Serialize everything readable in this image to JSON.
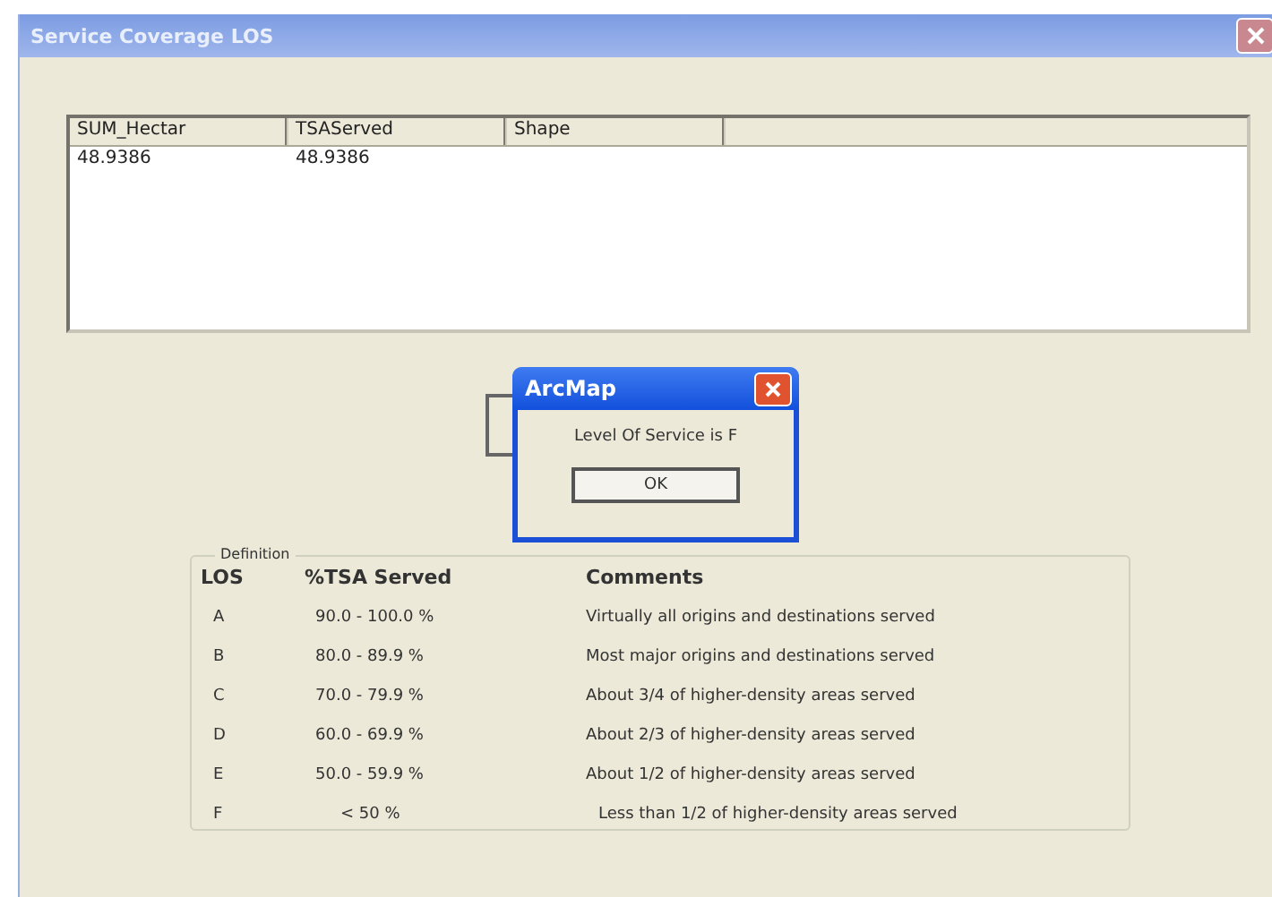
{
  "window": {
    "title": "Service Coverage LOS"
  },
  "table": {
    "columns": [
      "SUM_Hectar",
      "TSAServed",
      "Shape"
    ],
    "rows": [
      [
        "48.9386",
        "48.9386"
      ]
    ]
  },
  "message_box": {
    "title": "ArcMap",
    "message": "Level Of Service is F",
    "button": "OK"
  },
  "definition": {
    "title": "Definition",
    "headers": [
      "LOS",
      "%TSA Served",
      "Comments"
    ],
    "rows": [
      {
        "los": "A",
        "served": "90.0 - 100.0 %",
        "comment": "Virtually all origins and destinations served"
      },
      {
        "los": "B",
        "served": "80.0 - 89.9 %",
        "comment": "Most major origins and destinations served"
      },
      {
        "los": "C",
        "served": "70.0 - 79.9 %",
        "comment": "About 3/4 of higher-density areas served"
      },
      {
        "los": "D",
        "served": "60.0 - 69.9 %",
        "comment": "About 2/3 of higher-density areas served"
      },
      {
        "los": "E",
        "served": "50.0 - 59.9 %",
        "comment": "About 1/2 of higher-density areas served"
      },
      {
        "los": "F",
        "served": "< 50 %",
        "comment": "Less than 1/2 of higher-density areas served"
      }
    ]
  }
}
